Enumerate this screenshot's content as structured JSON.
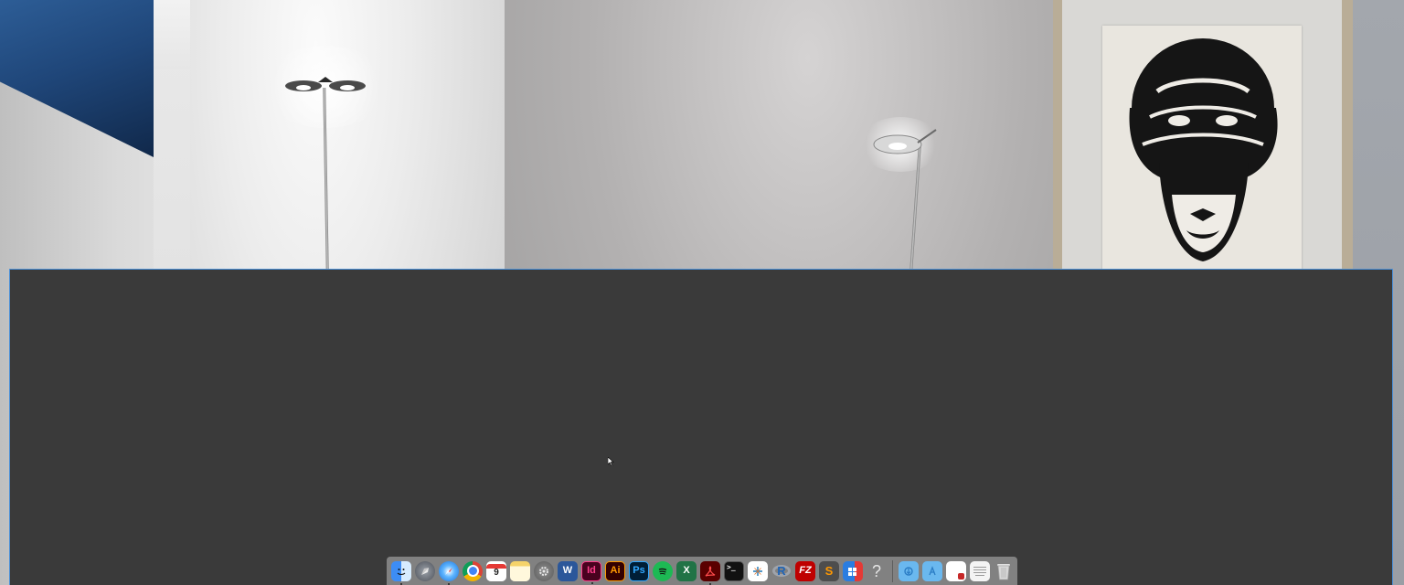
{
  "wallpaper": {
    "window_glass_color": "#1f4679",
    "wall_color": "#b3b1b1",
    "window_border_color": "#4a90d9"
  },
  "app_window": {
    "background": "#3a3a3a"
  },
  "dock": {
    "apps": [
      {
        "icon": "finder-icon",
        "running": true
      },
      {
        "icon": "launchpad-icon",
        "running": false
      },
      {
        "icon": "safari-icon",
        "running": true
      },
      {
        "icon": "chrome-icon",
        "running": false
      },
      {
        "icon": "calendar-icon",
        "running": false,
        "label": "9"
      },
      {
        "icon": "notes-icon",
        "running": false
      },
      {
        "icon": "system-preferences-icon",
        "running": false
      },
      {
        "icon": "word-icon",
        "running": false,
        "label": "W"
      },
      {
        "icon": "indesign-icon",
        "running": true,
        "label": "Id"
      },
      {
        "icon": "illustrator-icon",
        "running": false,
        "label": "Ai"
      },
      {
        "icon": "photoshop-icon",
        "running": false,
        "label": "Ps"
      },
      {
        "icon": "spotify-icon",
        "running": false
      },
      {
        "icon": "excel-icon",
        "running": false,
        "label": "X"
      },
      {
        "icon": "acrobat-icon",
        "running": true
      },
      {
        "icon": "terminal-icon",
        "running": false,
        "label": ">_"
      },
      {
        "icon": "tableau-icon",
        "running": false
      },
      {
        "icon": "r-icon",
        "running": false,
        "label": "R"
      },
      {
        "icon": "filezilla-icon",
        "running": false,
        "label": "FZ"
      },
      {
        "icon": "sublime-text-icon",
        "running": false,
        "label": "S"
      },
      {
        "icon": "parallels-icon",
        "running": false
      },
      {
        "icon": "help-icon",
        "running": false,
        "label": "?"
      }
    ],
    "folders": [
      {
        "icon": "downloads-folder-icon"
      },
      {
        "icon": "applications-folder-icon"
      },
      {
        "icon": "pdf-document-icon"
      },
      {
        "icon": "text-document-icon"
      },
      {
        "icon": "trash-icon"
      }
    ]
  }
}
